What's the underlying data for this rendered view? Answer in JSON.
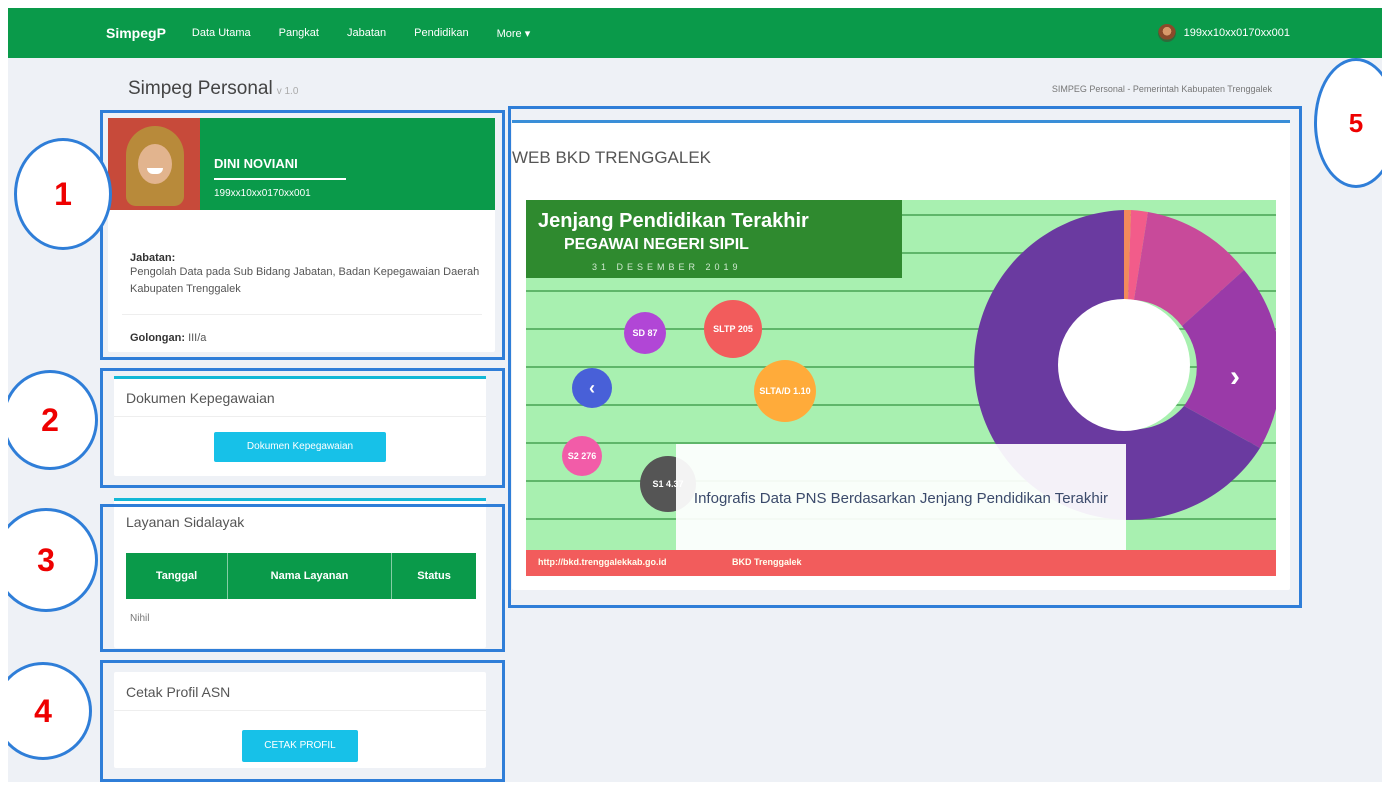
{
  "navbar": {
    "brand": "SimpegP",
    "items": [
      "Data Utama",
      "Pangkat",
      "Jabatan",
      "Pendidikan",
      "More ▾"
    ],
    "user_id": "199xx10xx0170xx001"
  },
  "header": {
    "title": "Simpeg Personal",
    "version": "v 1.0",
    "breadcrumb": "SIMPEG Personal - Pemerintah Kabupaten Trenggalek"
  },
  "profile": {
    "name": "DINI NOVIANI",
    "nip": "199xx10xx0170xx001",
    "jabatan_label": "Jabatan:",
    "jabatan_value": "Pengolah Data pada Sub Bidang Jabatan, Badan Kepegawaian Daerah Kabupaten Trenggalek",
    "golongan_label": "Golongan:",
    "golongan_value": "III/a"
  },
  "dokumen": {
    "heading": "Dokumen Kepegawaian",
    "button": "Dokumen Kepegawaian"
  },
  "layanan": {
    "heading": "Layanan Sidalayak",
    "columns": [
      "Tanggal",
      "Nama Layanan",
      "Status"
    ],
    "empty": "Nihil"
  },
  "cetak": {
    "heading": "Cetak Profil ASN",
    "button": "CETAK PROFIL"
  },
  "web": {
    "heading": "WEB BKD TRENGGALEK",
    "slide_title_1": "Jenjang Pendidikan Terakhir",
    "slide_title_2": "PEGAWAI NEGERI SIPIL",
    "slide_date": "31 DESEMBER 2019",
    "bubbles": [
      "SD 87",
      "SLTP 205",
      "SLTA/D 1.10",
      "S2 276",
      "S1 4.37"
    ],
    "caption": "Infografis Data PNS Berdasarkan Jenjang Pendidikan Terakhir",
    "footer_url": "http://bkd.trenggalekkab.go.id",
    "footer_fb": "BKD Trenggalek"
  },
  "annotations": [
    "1",
    "2",
    "3",
    "4",
    "5"
  ],
  "colors": {
    "navbar": "#0a9a4a",
    "button": "#17c1e8",
    "annotation_border": "#2f7ed8",
    "annotation_text": "#e00000"
  }
}
